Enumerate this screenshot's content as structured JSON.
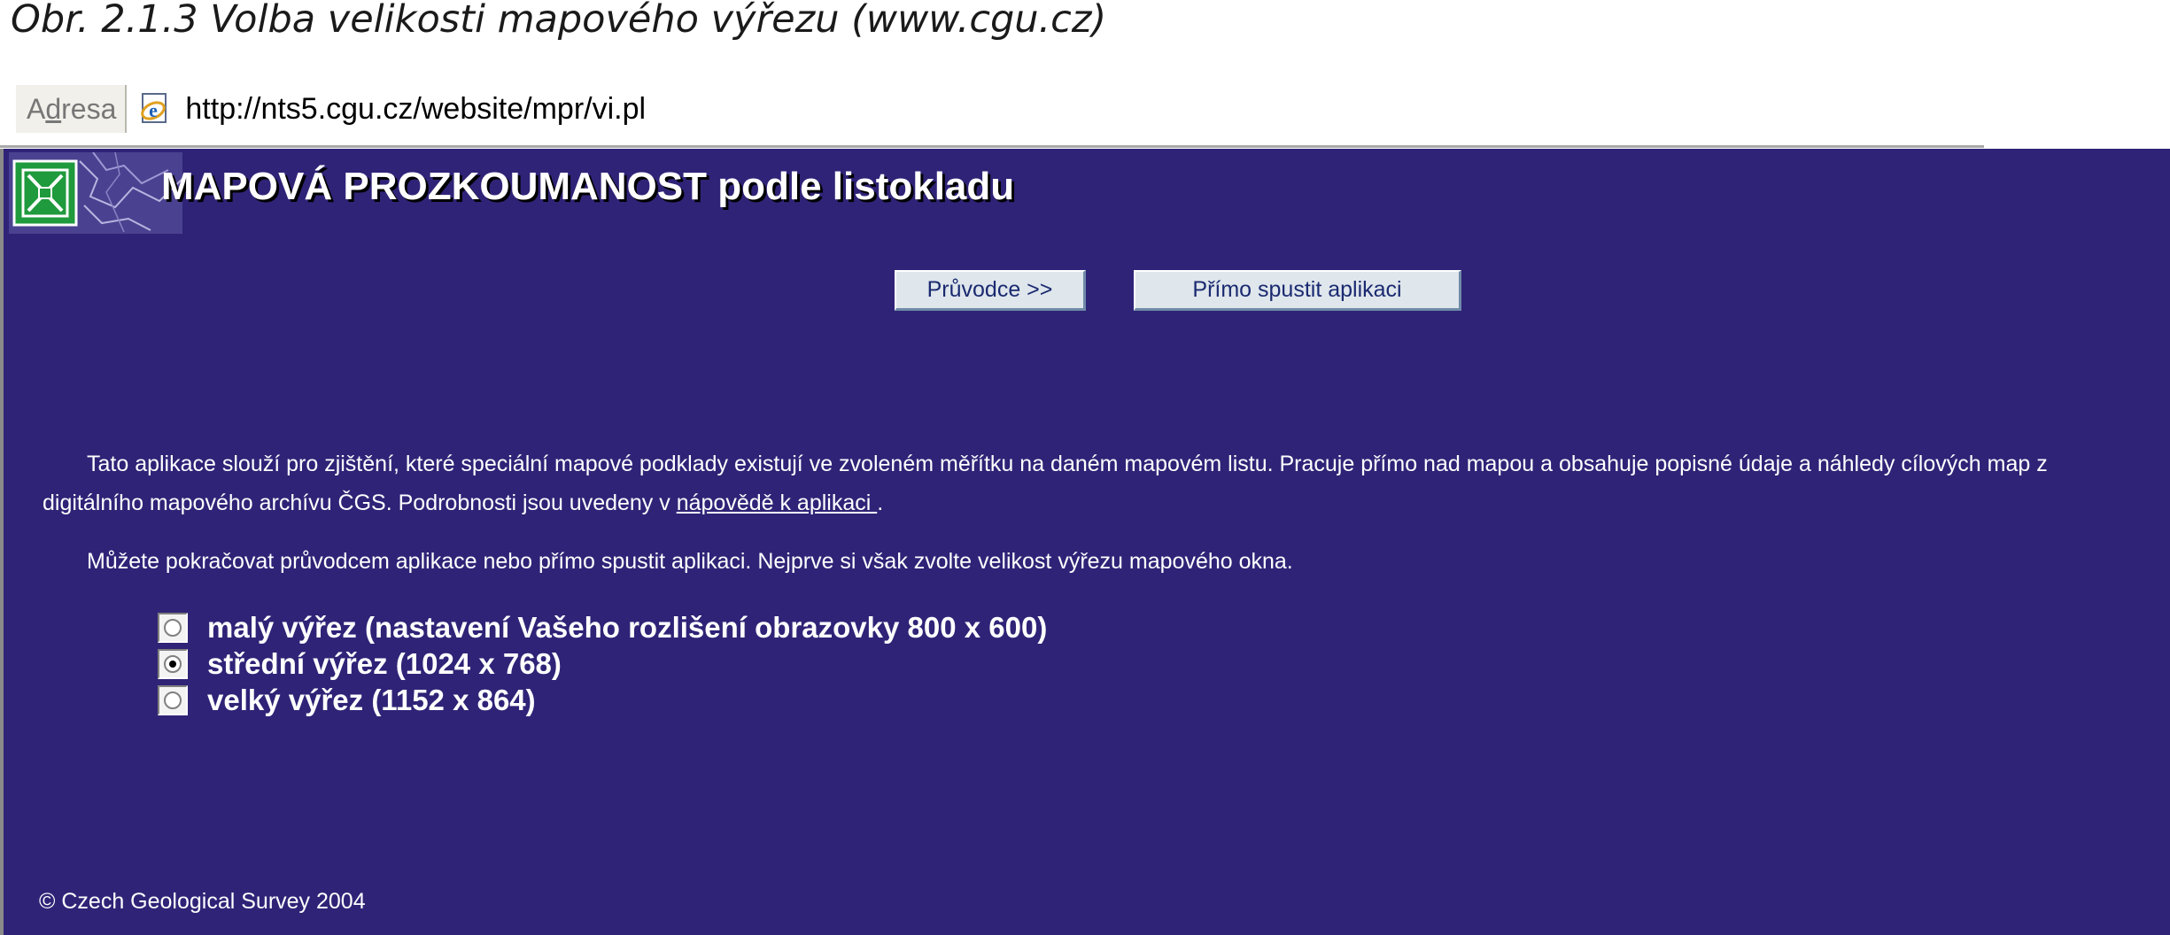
{
  "caption": "Obr. 2.1.3 Volba velikosti mapového výřezu (www.cgu.cz)",
  "addressbar": {
    "label_prefix": "A",
    "label_accel": "d",
    "label_suffix": "resa",
    "icon": "ie-page-icon",
    "url": "http://nts5.cgu.cz/website/mpr/vi.pl"
  },
  "app": {
    "title": "MAPOVÁ PROZKOUMANOST podle listokladu",
    "logo_icon": "cgs-logo-icon"
  },
  "buttons": {
    "guide": "Průvodce >>",
    "start": "Přímo spustit aplikaci"
  },
  "intro": {
    "text": "Tato aplikace slouží pro zjištění, které speciální mapové podklady existují ve zvoleném měřítku na daném mapovém listu. Pracuje přímo nad mapou a obsahuje popisné údaje a náhledy cílových map z digitálního mapového archívu ČGS. Podrobnosti jsou uvedeny v ",
    "link": "nápovědě k aplikaci ",
    "after": "."
  },
  "para2": "Můžete pokračovat průvodcem aplikace nebo přímo spustit aplikaci. Nejprve si však zvolte velikost výřezu mapového okna.",
  "options": [
    {
      "label": "malý výřez (nastavení Vašeho rozlišení obrazovky 800 x 600)",
      "selected": false
    },
    {
      "label": "střední výřez (1024 x 768)",
      "selected": true
    },
    {
      "label": "velký výřez (1152 x 864)",
      "selected": false
    }
  ],
  "footer": "© Czech Geological Survey 2004",
  "colors": {
    "page_bg": "#2f2377",
    "button_bg": "#dfe6ec",
    "button_text": "#1a2a70",
    "logo_green": "#1f9a3c"
  }
}
